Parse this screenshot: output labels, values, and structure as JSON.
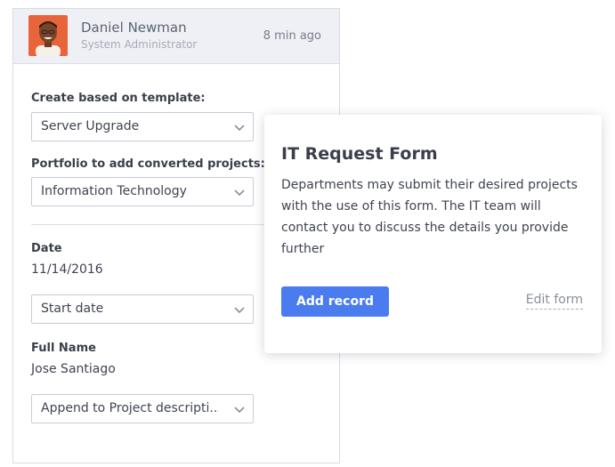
{
  "header": {
    "user_name": "Daniel Newman",
    "user_role": "System Administrator",
    "timestamp": "8 min ago"
  },
  "form": {
    "template_label": "Create based on template:",
    "template_value": "Server Upgrade",
    "portfolio_label": "Portfolio to add converted projects:",
    "portfolio_value": "Information Technology",
    "date_label": "Date",
    "date_value": "11/14/2016",
    "date_mapping": "Start date",
    "name_label": "Full Name",
    "name_value": "Jose Santiago",
    "name_mapping": "Append to Project descripti..."
  },
  "popover": {
    "title": "IT Request Form",
    "description": "Departments may submit their desired projects with the use of this form. The IT team will contact you to discuss the details you provide further",
    "add_button": "Add record",
    "edit_link": "Edit form"
  },
  "colors": {
    "accent": "#4a7cf0",
    "header_bg": "#eef0f5"
  },
  "icons": {
    "dropdown": "chevron-down-icon",
    "avatar": "user-avatar"
  }
}
